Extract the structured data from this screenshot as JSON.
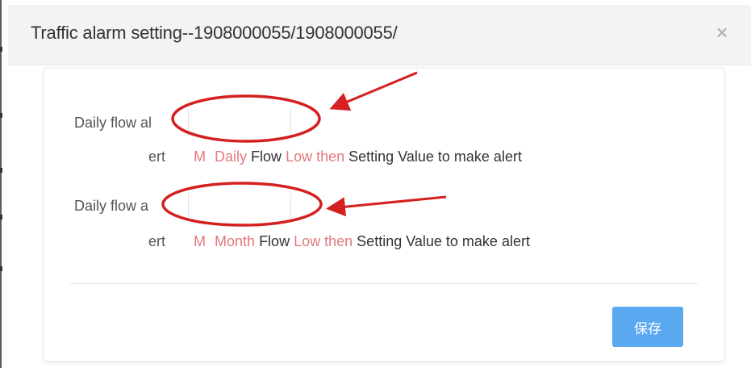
{
  "dialog": {
    "title": "Traffic alarm setting--1908000055/1908000055/",
    "close_glyph": "×"
  },
  "form": {
    "daily_row": {
      "label": "Daily flow al",
      "value": "",
      "hint_prefix": "ert",
      "hint_m": "M",
      "hint_period": "Daily",
      "hint_flow": "Flow",
      "hint_cond": "Low then",
      "hint_tail": "Setting Value to make alert"
    },
    "monthly_row": {
      "label": "Daily flow a",
      "value": "",
      "hint_prefix": "ert",
      "hint_m": "M",
      "hint_period": "Month",
      "hint_flow": "Flow",
      "hint_cond": "Low then",
      "hint_tail": "Setting Value to make alert"
    }
  },
  "actions": {
    "save_label": "保存"
  },
  "colors": {
    "accent_button": "#5aa9f0",
    "hint_highlight": "#e3787d",
    "annotation_red": "#d42020"
  }
}
